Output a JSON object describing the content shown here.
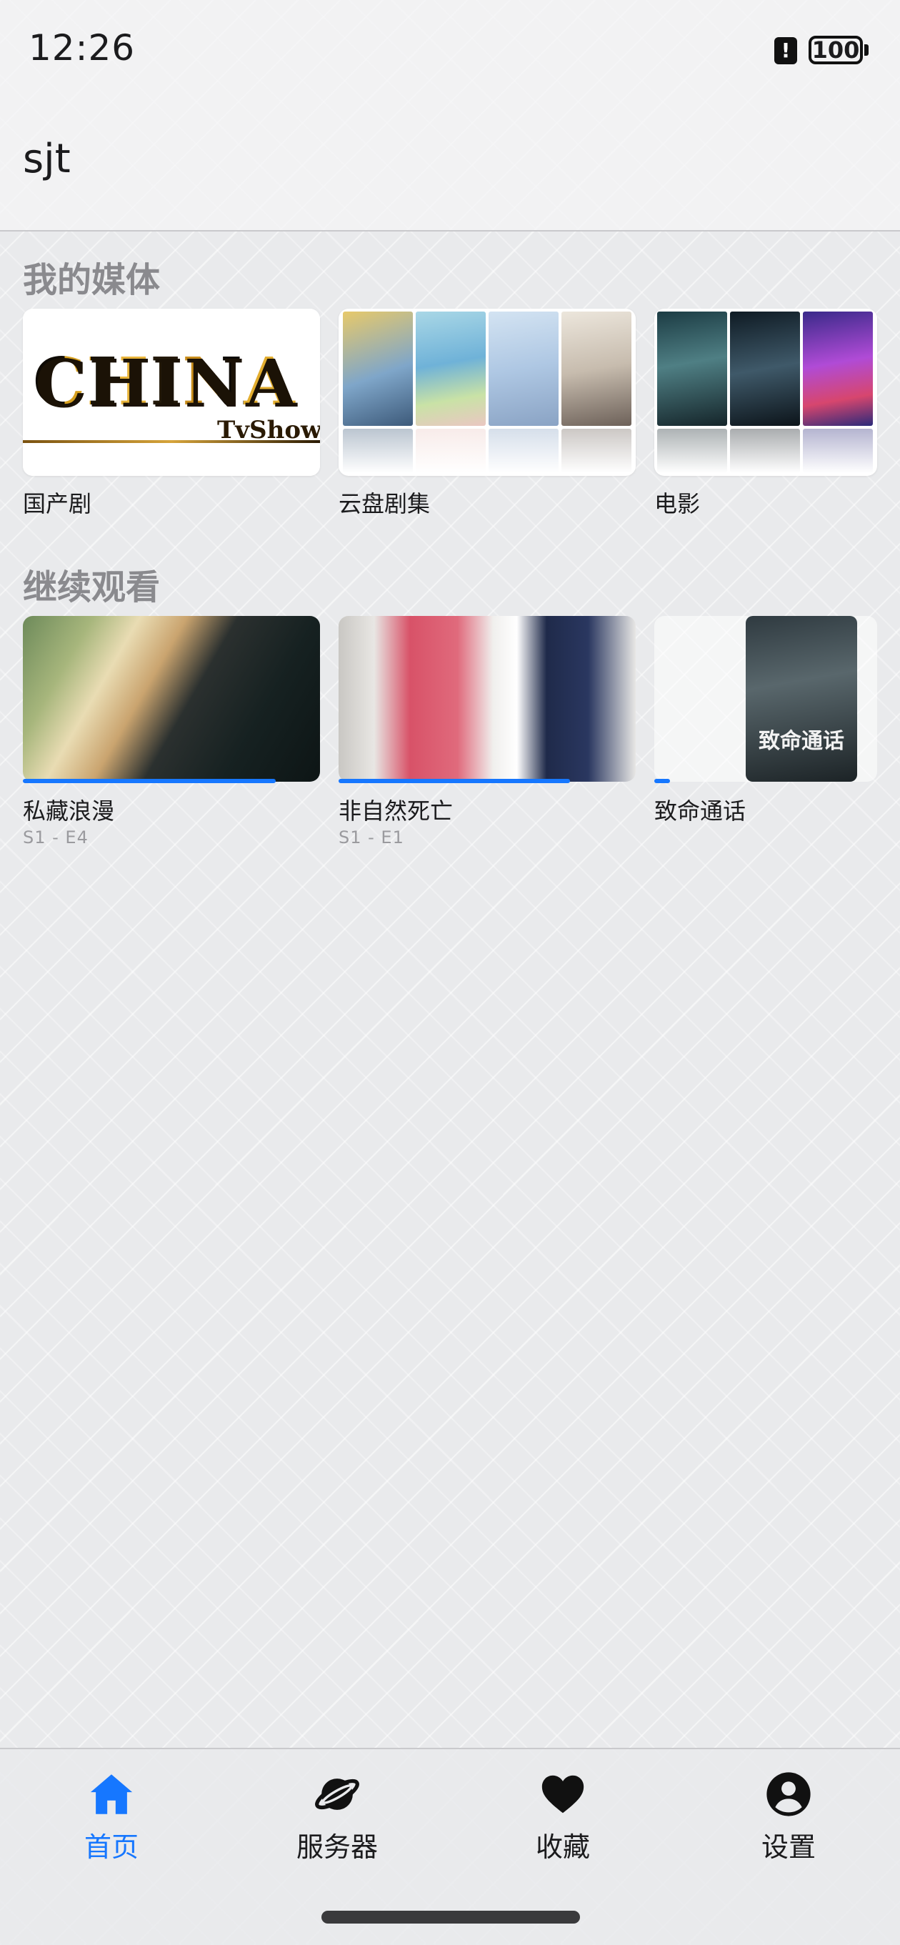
{
  "status_bar": {
    "time": "12:26",
    "battery": "100",
    "alert_icon": "alert-icon"
  },
  "header": {
    "title": "sjt"
  },
  "my_media": {
    "title": "我的媒体",
    "items": [
      {
        "label": "国产剧",
        "banner_word": "CHINA",
        "banner_sub": "TvShow"
      },
      {
        "label": "云盘剧集"
      },
      {
        "label": "电影"
      }
    ]
  },
  "continue_watching": {
    "title": "继续观看",
    "items": [
      {
        "title": "私藏浪漫",
        "episode": "S1 - E4",
        "progress": 0.85
      },
      {
        "title": "非自然死亡",
        "episode": "S1 - E1",
        "progress": 0.78
      },
      {
        "title": "致命通话",
        "episode": "",
        "progress": 0.07,
        "poster_text": "致命通话"
      }
    ]
  },
  "bottom_nav": {
    "items": [
      {
        "label": "首页",
        "icon": "home-icon",
        "active": true
      },
      {
        "label": "服务器",
        "icon": "planet-icon",
        "active": false
      },
      {
        "label": "收藏",
        "icon": "heart-icon",
        "active": false
      },
      {
        "label": "设置",
        "icon": "user-circle-icon",
        "active": false
      }
    ]
  },
  "colors": {
    "accent": "#1677ff",
    "section_title": "#8a8a8e",
    "background": "#e9eaec"
  }
}
